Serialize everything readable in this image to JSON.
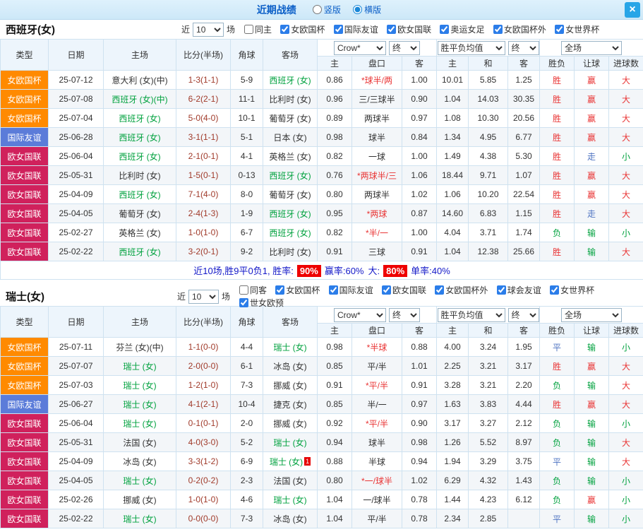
{
  "titlebar": {
    "title": "近期战绩",
    "views": [
      {
        "label": "竖版",
        "selected": false
      },
      {
        "label": "横版",
        "selected": true
      }
    ],
    "close": "×"
  },
  "columns": {
    "type": "类型",
    "date": "日期",
    "home": "主场",
    "score": "比分(半场)",
    "corner": "角球",
    "away": "客场",
    "h": "主",
    "handicap": "盘口",
    "a": "客",
    "win": "主",
    "draw": "和",
    "lose": "客",
    "result": "胜负",
    "hcp_result": "让球",
    "goals": "进球数"
  },
  "spain": {
    "title": "西班牙(女)",
    "filter": {
      "near": "近",
      "count": "10",
      "games": "场"
    },
    "checks": [
      {
        "label": "同主",
        "checked": false
      },
      {
        "label": "女欧国杯",
        "checked": true
      },
      {
        "label": "国际友谊",
        "checked": true
      },
      {
        "label": "欧女国联",
        "checked": true
      },
      {
        "label": "奥运女足",
        "checked": true
      },
      {
        "label": "女欧国杯外",
        "checked": true
      },
      {
        "label": "女世界杯",
        "checked": true
      }
    ],
    "dropdowns": {
      "source": "Crow*",
      "t1": "终",
      "mean": "胜平负均值",
      "t2": "终",
      "scope": "全场"
    },
    "rows": [
      {
        "lg": "女欧国杯",
        "lgc": "lg-orange",
        "date": "25-07-12",
        "home": "意大利 (女)(中)",
        "homec": "",
        "score": "1-3(1-1)",
        "corner": "5-9",
        "away": "西班牙 (女)",
        "awayc": "t-green",
        "sup": "",
        "hw": "0.86",
        "hcp": "*球半/两",
        "hcpc": "c-red",
        "aw": "1.00",
        "ow": "10.01",
        "od": "5.85",
        "ol": "1.25",
        "res": "胜",
        "resc": "c-red",
        "hr": "赢",
        "hrc": "c-red",
        "gl": "大",
        "glc": "c-red"
      },
      {
        "lg": "女欧国杯",
        "lgc": "lg-orange",
        "date": "25-07-08",
        "home": "西班牙 (女)(中)",
        "homec": "t-green",
        "score": "6-2(2-1)",
        "corner": "11-1",
        "away": "比利时 (女)",
        "awayc": "",
        "sup": "",
        "hw": "0.96",
        "hcp": "三/三球半",
        "hcpc": "",
        "aw": "0.90",
        "ow": "1.04",
        "od": "14.03",
        "ol": "30.35",
        "res": "胜",
        "resc": "c-red",
        "hr": "赢",
        "hrc": "c-red",
        "gl": "大",
        "glc": "c-red"
      },
      {
        "lg": "女欧国杯",
        "lgc": "lg-orange",
        "date": "25-07-04",
        "home": "西班牙 (女)",
        "homec": "t-green",
        "score": "5-0(4-0)",
        "corner": "10-1",
        "away": "葡萄牙 (女)",
        "awayc": "",
        "sup": "",
        "hw": "0.89",
        "hcp": "两球半",
        "hcpc": "",
        "aw": "0.97",
        "ow": "1.08",
        "od": "10.30",
        "ol": "20.56",
        "res": "胜",
        "resc": "c-red",
        "hr": "赢",
        "hrc": "c-red",
        "gl": "大",
        "glc": "c-red"
      },
      {
        "lg": "国际友谊",
        "lgc": "lg-blue",
        "date": "25-06-28",
        "home": "西班牙 (女)",
        "homec": "t-green",
        "score": "3-1(1-1)",
        "corner": "5-1",
        "away": "日本 (女)",
        "awayc": "",
        "sup": "",
        "hw": "0.98",
        "hcp": "球半",
        "hcpc": "",
        "aw": "0.84",
        "ow": "1.34",
        "od": "4.95",
        "ol": "6.77",
        "res": "胜",
        "resc": "c-red",
        "hr": "赢",
        "hrc": "c-red",
        "gl": "大",
        "glc": "c-red"
      },
      {
        "lg": "欧女国联",
        "lgc": "lg-pink",
        "date": "25-06-04",
        "home": "西班牙 (女)",
        "homec": "t-green",
        "score": "2-1(0-1)",
        "corner": "4-1",
        "away": "英格兰 (女)",
        "awayc": "",
        "sup": "",
        "hw": "0.82",
        "hcp": "一球",
        "hcpc": "",
        "aw": "1.00",
        "ow": "1.49",
        "od": "4.38",
        "ol": "5.30",
        "res": "胜",
        "resc": "c-red",
        "hr": "走",
        "hrc": "c-blue",
        "gl": "小",
        "glc": "c-green"
      },
      {
        "lg": "欧女国联",
        "lgc": "lg-pink",
        "date": "25-05-31",
        "home": "比利时 (女)",
        "homec": "",
        "score": "1-5(0-1)",
        "corner": "0-13",
        "away": "西班牙 (女)",
        "awayc": "t-green",
        "sup": "",
        "hw": "0.76",
        "hcp": "*两球半/三",
        "hcpc": "c-red",
        "aw": "1.06",
        "ow": "18.44",
        "od": "9.71",
        "ol": "1.07",
        "res": "胜",
        "resc": "c-red",
        "hr": "赢",
        "hrc": "c-red",
        "gl": "大",
        "glc": "c-red"
      },
      {
        "lg": "欧女国联",
        "lgc": "lg-pink",
        "date": "25-04-09",
        "home": "西班牙 (女)",
        "homec": "t-green",
        "score": "7-1(4-0)",
        "corner": "8-0",
        "away": "葡萄牙 (女)",
        "awayc": "",
        "sup": "",
        "hw": "0.80",
        "hcp": "两球半",
        "hcpc": "",
        "aw": "1.02",
        "ow": "1.06",
        "od": "10.20",
        "ol": "22.54",
        "res": "胜",
        "resc": "c-red",
        "hr": "赢",
        "hrc": "c-red",
        "gl": "大",
        "glc": "c-red"
      },
      {
        "lg": "欧女国联",
        "lgc": "lg-pink",
        "date": "25-04-05",
        "home": "葡萄牙 (女)",
        "homec": "",
        "score": "2-4(1-3)",
        "corner": "1-9",
        "away": "西班牙 (女)",
        "awayc": "t-green",
        "sup": "",
        "hw": "0.95",
        "hcp": "*两球",
        "hcpc": "c-red",
        "aw": "0.87",
        "ow": "14.60",
        "od": "6.83",
        "ol": "1.15",
        "res": "胜",
        "resc": "c-red",
        "hr": "走",
        "hrc": "c-blue",
        "gl": "大",
        "glc": "c-red"
      },
      {
        "lg": "欧女国联",
        "lgc": "lg-pink",
        "date": "25-02-27",
        "home": "英格兰 (女)",
        "homec": "",
        "score": "1-0(1-0)",
        "corner": "6-7",
        "away": "西班牙 (女)",
        "awayc": "t-green",
        "sup": "",
        "hw": "0.82",
        "hcp": "*半/一",
        "hcpc": "c-red",
        "aw": "1.00",
        "ow": "4.04",
        "od": "3.71",
        "ol": "1.74",
        "res": "负",
        "resc": "c-green",
        "hr": "输",
        "hrc": "c-green",
        "gl": "小",
        "glc": "c-green"
      },
      {
        "lg": "欧女国联",
        "lgc": "lg-pink",
        "date": "25-02-22",
        "home": "西班牙 (女)",
        "homec": "t-green",
        "score": "3-2(0-1)",
        "corner": "9-2",
        "away": "比利时 (女)",
        "awayc": "",
        "sup": "",
        "hw": "0.91",
        "hcp": "三球",
        "hcpc": "",
        "aw": "0.91",
        "ow": "1.04",
        "od": "12.38",
        "ol": "25.66",
        "res": "胜",
        "resc": "c-red",
        "hr": "输",
        "hrc": "c-green",
        "gl": "大",
        "glc": "c-red"
      }
    ],
    "summary": {
      "prefix": "近10场,胜9平0负1, 胜率:",
      "win_rate": "90%",
      "mid1": "赢率:60%",
      "mid2": "大:",
      "big_rate": "80%",
      "tail": "单率:40%"
    }
  },
  "swiss": {
    "title": "瑞士(女)",
    "filter": {
      "near": "近",
      "count": "10",
      "games": "场"
    },
    "checks": [
      {
        "label": "同客",
        "checked": false
      },
      {
        "label": "女欧国杯",
        "checked": true
      },
      {
        "label": "国际友谊",
        "checked": true
      },
      {
        "label": "欧女国联",
        "checked": true
      },
      {
        "label": "女欧国杯外",
        "checked": true
      },
      {
        "label": "球会友谊",
        "checked": true
      },
      {
        "label": "女世界杯",
        "checked": true
      },
      {
        "label": "世女欧预",
        "checked": true
      }
    ],
    "dropdowns": {
      "source": "Crow*",
      "t1": "终",
      "mean": "胜平负均值",
      "t2": "终",
      "scope": "全场"
    },
    "rows": [
      {
        "lg": "女欧国杯",
        "lgc": "lg-orange",
        "date": "25-07-11",
        "home": "芬兰 (女)(中)",
        "homec": "",
        "score": "1-1(0-0)",
        "corner": "4-4",
        "away": "瑞士 (女)",
        "awayc": "t-green",
        "sup": "",
        "hw": "0.98",
        "hcp": "*半球",
        "hcpc": "c-red",
        "aw": "0.88",
        "ow": "4.00",
        "od": "3.24",
        "ol": "1.95",
        "res": "平",
        "resc": "c-blue",
        "hr": "输",
        "hrc": "c-green",
        "gl": "小",
        "glc": "c-green"
      },
      {
        "lg": "女欧国杯",
        "lgc": "lg-orange",
        "date": "25-07-07",
        "home": "瑞士 (女)",
        "homec": "t-green",
        "score": "2-0(0-0)",
        "corner": "6-1",
        "away": "冰岛 (女)",
        "awayc": "",
        "sup": "",
        "hw": "0.85",
        "hcp": "平/半",
        "hcpc": "",
        "aw": "1.01",
        "ow": "2.25",
        "od": "3.21",
        "ol": "3.17",
        "res": "胜",
        "resc": "c-red",
        "hr": "赢",
        "hrc": "c-red",
        "gl": "大",
        "glc": "c-red"
      },
      {
        "lg": "女欧国杯",
        "lgc": "lg-orange",
        "date": "25-07-03",
        "home": "瑞士 (女)",
        "homec": "t-green",
        "score": "1-2(1-0)",
        "corner": "7-3",
        "away": "挪威 (女)",
        "awayc": "",
        "sup": "",
        "hw": "0.91",
        "hcp": "*平/半",
        "hcpc": "c-red",
        "aw": "0.91",
        "ow": "3.28",
        "od": "3.21",
        "ol": "2.20",
        "res": "负",
        "resc": "c-green",
        "hr": "输",
        "hrc": "c-green",
        "gl": "大",
        "glc": "c-red"
      },
      {
        "lg": "国际友谊",
        "lgc": "lg-blue",
        "date": "25-06-27",
        "home": "瑞士 (女)",
        "homec": "t-green",
        "score": "4-1(2-1)",
        "corner": "10-4",
        "away": "捷克 (女)",
        "awayc": "",
        "sup": "",
        "hw": "0.85",
        "hcp": "半/一",
        "hcpc": "",
        "aw": "0.97",
        "ow": "1.63",
        "od": "3.83",
        "ol": "4.44",
        "res": "胜",
        "resc": "c-red",
        "hr": "赢",
        "hrc": "c-red",
        "gl": "大",
        "glc": "c-red"
      },
      {
        "lg": "欧女国联",
        "lgc": "lg-pink",
        "date": "25-06-04",
        "home": "瑞士 (女)",
        "homec": "t-green",
        "score": "0-1(0-1)",
        "corner": "2-0",
        "away": "挪威 (女)",
        "awayc": "",
        "sup": "",
        "hw": "0.92",
        "hcp": "*平/半",
        "hcpc": "c-red",
        "aw": "0.90",
        "ow": "3.17",
        "od": "3.27",
        "ol": "2.12",
        "res": "负",
        "resc": "c-green",
        "hr": "输",
        "hrc": "c-green",
        "gl": "小",
        "glc": "c-green"
      },
      {
        "lg": "欧女国联",
        "lgc": "lg-pink",
        "date": "25-05-31",
        "home": "法国 (女)",
        "homec": "",
        "score": "4-0(3-0)",
        "corner": "5-2",
        "away": "瑞士 (女)",
        "awayc": "t-green",
        "sup": "",
        "hw": "0.94",
        "hcp": "球半",
        "hcpc": "",
        "aw": "0.98",
        "ow": "1.26",
        "od": "5.52",
        "ol": "8.97",
        "res": "负",
        "resc": "c-green",
        "hr": "输",
        "hrc": "c-green",
        "gl": "大",
        "glc": "c-red"
      },
      {
        "lg": "欧女国联",
        "lgc": "lg-pink",
        "date": "25-04-09",
        "home": "冰岛 (女)",
        "homec": "",
        "score": "3-3(1-2)",
        "corner": "6-9",
        "away": "瑞士 (女)",
        "awayc": "t-green",
        "sup": "1",
        "hw": "0.88",
        "hcp": "半球",
        "hcpc": "",
        "aw": "0.94",
        "ow": "1.94",
        "od": "3.29",
        "ol": "3.75",
        "res": "平",
        "resc": "c-blue",
        "hr": "输",
        "hrc": "c-green",
        "gl": "大",
        "glc": "c-red"
      },
      {
        "lg": "欧女国联",
        "lgc": "lg-pink",
        "date": "25-04-05",
        "home": "瑞士 (女)",
        "homec": "t-green",
        "score": "0-2(0-2)",
        "corner": "2-3",
        "away": "法国 (女)",
        "awayc": "",
        "sup": "",
        "hw": "0.80",
        "hcp": "*一/球半",
        "hcpc": "c-red",
        "aw": "1.02",
        "ow": "6.29",
        "od": "4.32",
        "ol": "1.43",
        "res": "负",
        "resc": "c-green",
        "hr": "输",
        "hrc": "c-green",
        "gl": "小",
        "glc": "c-green"
      },
      {
        "lg": "欧女国联",
        "lgc": "lg-pink",
        "date": "25-02-26",
        "home": "挪威 (女)",
        "homec": "",
        "score": "1-0(1-0)",
        "corner": "4-6",
        "away": "瑞士 (女)",
        "awayc": "t-green",
        "sup": "",
        "hw": "1.04",
        "hcp": "一/球半",
        "hcpc": "",
        "aw": "0.78",
        "ow": "1.44",
        "od": "4.23",
        "ol": "6.12",
        "res": "负",
        "resc": "c-green",
        "hr": "赢",
        "hrc": "c-red",
        "gl": "小",
        "glc": "c-green"
      },
      {
        "lg": "欧女国联",
        "lgc": "lg-pink",
        "date": "25-02-22",
        "home": "瑞士 (女)",
        "homec": "t-green",
        "score": "0-0(0-0)",
        "corner": "7-3",
        "away": "冰岛 (女)",
        "awayc": "",
        "sup": "",
        "hw": "1.04",
        "hcp": "平/半",
        "hcpc": "",
        "aw": "0.78",
        "ow": "2.34",
        "od": "2.85",
        "ol": "",
        "res": "平",
        "resc": "c-blue",
        "hr": "输",
        "hrc": "c-green",
        "gl": "小",
        "glc": "c-green"
      }
    ]
  }
}
